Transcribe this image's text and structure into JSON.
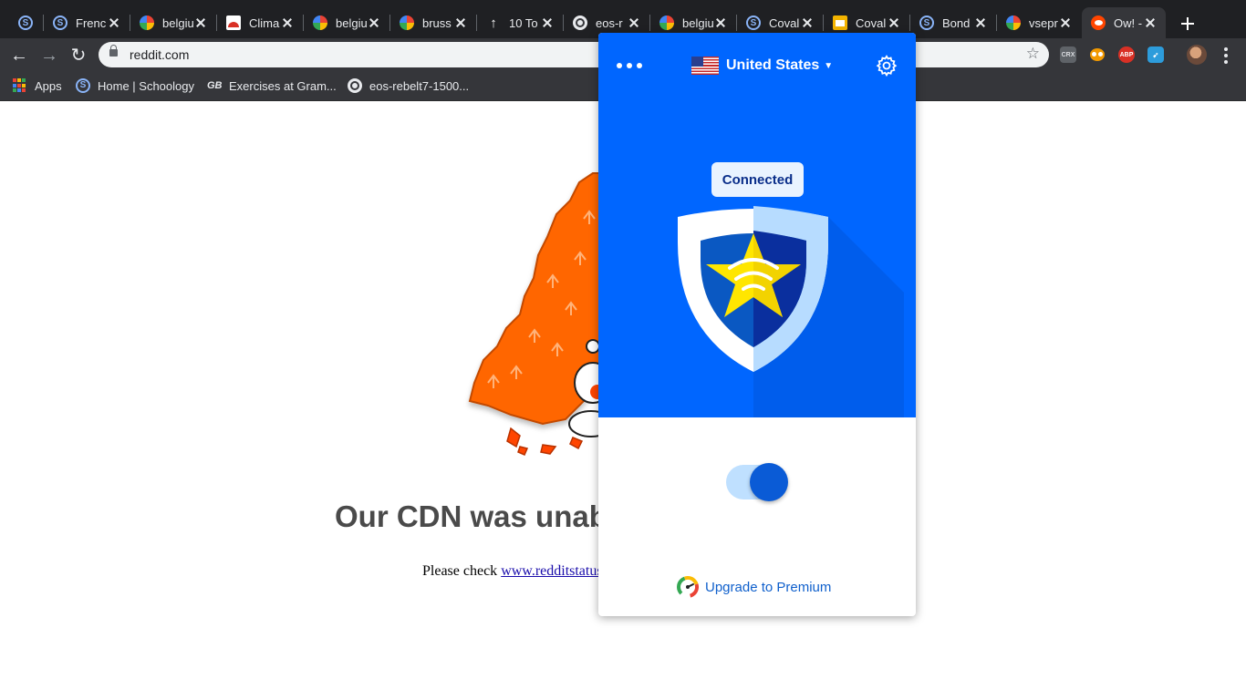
{
  "browser": {
    "tabs": [
      {
        "title": "",
        "favicon": "schoology-icon"
      },
      {
        "title": "Frenc",
        "favicon": "schoology-icon"
      },
      {
        "title": "belgiu",
        "favicon": "google-icon"
      },
      {
        "title": "Clima",
        "favicon": "red-logo-icon"
      },
      {
        "title": "belgiu",
        "favicon": "google-icon"
      },
      {
        "title": "bruss",
        "favicon": "google-icon"
      },
      {
        "title": "10 To",
        "favicon": "arrow-up-icon"
      },
      {
        "title": "eos-r",
        "favicon": "globe-icon"
      },
      {
        "title": "belgiu",
        "favicon": "google-icon"
      },
      {
        "title": "Coval",
        "favicon": "schoology-icon"
      },
      {
        "title": "Coval",
        "favicon": "slides-icon"
      },
      {
        "title": "Bond",
        "favicon": "schoology-icon"
      },
      {
        "title": "vsepr",
        "favicon": "google-icon"
      },
      {
        "title": "Ow! -",
        "favicon": "reddit-icon",
        "active": true
      }
    ],
    "address": "reddit.com",
    "extensions": [
      "CRX",
      "owl",
      "ABP",
      "arrow"
    ],
    "bookmarks": [
      {
        "label": "Apps",
        "icon": "apps-grid-icon"
      },
      {
        "label": "Home | Schoology",
        "icon": "schoology-icon"
      },
      {
        "label": "Exercises at Gram...",
        "icon": "gb-icon"
      },
      {
        "label": "eos-rebelt7-1500...",
        "icon": "globe-icon"
      }
    ]
  },
  "page": {
    "heading": "Our CDN was unab",
    "message_prefix": "Please check ",
    "message_link": "www.redditstatus"
  },
  "vpn": {
    "country": "United States",
    "status": "Connected",
    "connected": true,
    "upgrade_label": "Upgrade to Premium",
    "colors": {
      "primary": "#0066ff",
      "badge_text": "#0a2e8a",
      "toggle_knob": "#0a5bd6",
      "link": "#1060cc"
    }
  }
}
